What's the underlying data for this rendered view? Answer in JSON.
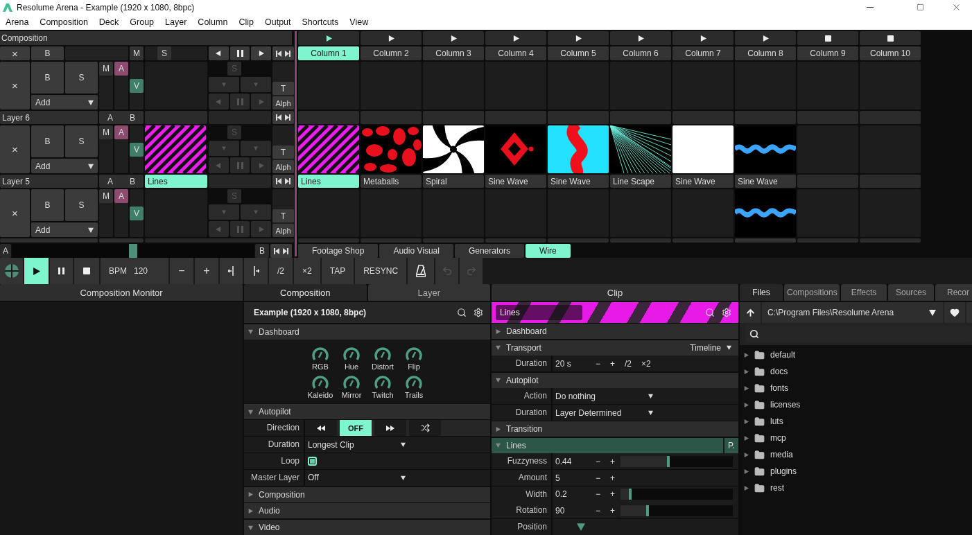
{
  "window": {
    "title": "Resolume Arena - Example (1920 x 1080, 8bpc)"
  },
  "menu": [
    "Arena",
    "Composition",
    "Deck",
    "Group",
    "Layer",
    "Column",
    "Clip",
    "Output",
    "Shortcuts",
    "View"
  ],
  "composition_bar": {
    "title": "Composition",
    "clear": "×",
    "bypass": "B",
    "mute": "M",
    "solo": "S"
  },
  "columns": [
    {
      "name": "Column 1",
      "kind": "play",
      "selected": true
    },
    {
      "name": "Column 2",
      "kind": "play",
      "selected": false
    },
    {
      "name": "Column 3",
      "kind": "play",
      "selected": false
    },
    {
      "name": "Column 4",
      "kind": "play",
      "selected": false
    },
    {
      "name": "Column 5",
      "kind": "play",
      "selected": false
    },
    {
      "name": "Column 6",
      "kind": "play",
      "selected": false
    },
    {
      "name": "Column 7",
      "kind": "play",
      "selected": false
    },
    {
      "name": "Column 8",
      "kind": "play",
      "selected": false
    },
    {
      "name": "Column 9",
      "kind": "stop",
      "selected": false
    },
    {
      "name": "Column 10",
      "kind": "stop",
      "selected": false
    }
  ],
  "layers": [
    {
      "name": "Layer 6",
      "clear": "×",
      "bypass": "B",
      "solo": "S",
      "add": "Add",
      "mute": "M",
      "audio": "A",
      "video": "V",
      "dim_solo": "S",
      "transition": "T",
      "blend": "Alph",
      "crossfade_a": "A",
      "crossfade_b": "B",
      "clips": [
        {
          "kind": "empty"
        },
        {
          "kind": "empty"
        },
        {
          "kind": "empty"
        },
        {
          "kind": "empty"
        },
        {
          "kind": "empty"
        },
        {
          "kind": "empty"
        },
        {
          "kind": "empty"
        },
        {
          "kind": "empty"
        },
        {
          "kind": "empty"
        },
        {
          "kind": "empty"
        }
      ]
    },
    {
      "name": "Layer 5",
      "clear": "×",
      "bypass": "B",
      "solo": "S",
      "add": "Add",
      "mute": "M",
      "audio": "A",
      "video": "V",
      "dim_solo": "S",
      "transition": "T",
      "blend": "Alph",
      "crossfade_a": "A",
      "crossfade_b": "B",
      "preview": {
        "name": "Lines",
        "kind": "lines"
      },
      "clips": [
        {
          "name": "Lines",
          "kind": "lines",
          "selected": true
        },
        {
          "name": "Metaballs",
          "kind": "metaballs",
          "selected": false
        },
        {
          "name": "Spiral",
          "kind": "spiral",
          "selected": false
        },
        {
          "name": "Sine Wave",
          "kind": "sinewave_red",
          "selected": false
        },
        {
          "name": "Sine Wave",
          "kind": "sinewave_cyan",
          "selected": false
        },
        {
          "name": "Line Scape",
          "kind": "linescape",
          "selected": false
        },
        {
          "name": "Sine Wave",
          "kind": "white",
          "selected": false
        },
        {
          "name": "Sine Wave",
          "kind": "sinewave_blue",
          "selected": false
        },
        {
          "kind": "empty"
        },
        {
          "kind": "empty"
        }
      ]
    },
    {
      "clear": "×",
      "bypass": "B",
      "solo": "S",
      "add": "Add",
      "mute": "M",
      "audio": "A",
      "video": "V",
      "dim_solo": "S",
      "transition": "T",
      "blend": "Alph",
      "clips": [
        {
          "kind": "empty"
        },
        {
          "kind": "empty"
        },
        {
          "kind": "empty"
        },
        {
          "kind": "empty"
        },
        {
          "kind": "empty"
        },
        {
          "kind": "empty"
        },
        {
          "kind": "empty"
        },
        {
          "kind": "sinewave_blue",
          "selected": false
        },
        {
          "kind": "empty"
        },
        {
          "kind": "empty"
        }
      ]
    }
  ],
  "crossfader": {
    "a": "A",
    "b": "B",
    "level": 0.5
  },
  "deck_tabs": [
    {
      "label": "Footage Shop",
      "selected": false
    },
    {
      "label": "Audio Visual",
      "selected": false
    },
    {
      "label": "Generators",
      "selected": false
    },
    {
      "label": "Wire",
      "selected": true
    }
  ],
  "transport": [
    {
      "kind": "logo"
    },
    {
      "kind": "play",
      "selected": true
    },
    {
      "kind": "pause",
      "selected": false
    },
    {
      "kind": "stop",
      "selected": false
    },
    {
      "kind": "bpm",
      "label": "BPM",
      "value": "120"
    },
    {
      "kind": "text",
      "label": "−"
    },
    {
      "kind": "text",
      "label": "+"
    },
    {
      "kind": "nudge_back"
    },
    {
      "kind": "nudge_forward"
    },
    {
      "kind": "text",
      "label": "/2"
    },
    {
      "kind": "text",
      "label": "×2"
    },
    {
      "kind": "text",
      "label": "TAP"
    },
    {
      "kind": "text",
      "label": "RESYNC"
    },
    {
      "kind": "metronome"
    },
    {
      "kind": "undo",
      "disabled": true
    },
    {
      "kind": "redo",
      "disabled": true
    }
  ],
  "monitor": {
    "title": "Composition Monitor"
  },
  "comp_panel": {
    "tabs": [
      {
        "label": "Composition",
        "selected": true
      },
      {
        "label": "Layer",
        "selected": false
      }
    ],
    "header": "Example (1920 x 1080, 8bpc)",
    "sections": [
      {
        "title": "Dashboard",
        "expanded": true,
        "knobs": [
          "RGB",
          "Hue",
          "Distort",
          "Flip",
          "Kaleido",
          "Mirror",
          "Twitch",
          "Trails"
        ]
      },
      {
        "title": "Autopilot",
        "expanded": true,
        "rows": [
          {
            "kind": "segmented",
            "label": "Direction",
            "options": [
              {
                "kind": "rewind",
                "selected": false
              },
              {
                "kind": "text",
                "label": "OFF",
                "selected": true
              },
              {
                "kind": "forward",
                "selected": false
              },
              {
                "kind": "shuffle",
                "selected": false
              }
            ]
          },
          {
            "kind": "dropdown",
            "label": "Duration",
            "value": "Longest Clip"
          },
          {
            "kind": "checkbox",
            "label": "Loop",
            "checked": true
          },
          {
            "kind": "dropdown",
            "label": "Master Layer",
            "value": "Off"
          }
        ]
      },
      {
        "title": "Composition",
        "expanded": false
      },
      {
        "title": "Audio",
        "expanded": false
      },
      {
        "title": "Video",
        "expanded": true
      }
    ]
  },
  "clip_panel": {
    "title": "Clip",
    "clip_name": "Lines",
    "sections": [
      {
        "title": "Dashboard",
        "expanded": false
      },
      {
        "title": "Transport",
        "expanded": true,
        "mode": "Timeline",
        "rows": [
          {
            "kind": "number",
            "label": "Duration",
            "value": "20 s",
            "buttons": [
              "−",
              "+",
              "/2",
              "×2"
            ]
          }
        ]
      },
      {
        "title": "Autopilot",
        "expanded": true,
        "rows": [
          {
            "kind": "dropdown",
            "label": "Action",
            "value": "Do nothing"
          },
          {
            "kind": "dropdown",
            "label": "Duration",
            "value": "Layer Determined"
          }
        ]
      },
      {
        "title": "Transition",
        "expanded": false
      },
      {
        "title": "Lines",
        "expanded": true,
        "active": true,
        "button": "P.",
        "rows": [
          {
            "kind": "slider",
            "label": "Fuzzyness",
            "value": "0.44",
            "buttons": [
              "−",
              "+"
            ],
            "level": 0.44
          },
          {
            "kind": "number",
            "label": "Amount",
            "value": "5",
            "buttons": [
              "−",
              "+"
            ]
          },
          {
            "kind": "slider",
            "label": "Width",
            "value": "0.2",
            "buttons": [
              "−",
              "+"
            ],
            "level": 0.1
          },
          {
            "kind": "slider",
            "label": "Rotation",
            "value": "90",
            "buttons": [
              "−",
              "+"
            ],
            "level": 0.25
          },
          {
            "kind": "position",
            "label": "Position",
            "level": 0.12
          }
        ]
      }
    ]
  },
  "files_panel": {
    "tabs": [
      {
        "label": "Files",
        "selected": true
      },
      {
        "label": "Compositions",
        "selected": false
      },
      {
        "label": "Effects",
        "selected": false
      },
      {
        "label": "Sources",
        "selected": false
      },
      {
        "label": "Recor",
        "selected": false
      }
    ],
    "path": "C:\\Program Files\\Resolume Arena",
    "folders": [
      {
        "name": "default",
        "expanded": false
      },
      {
        "name": "docs",
        "expanded": false
      },
      {
        "name": "fonts",
        "expanded": false
      },
      {
        "name": "licenses",
        "expanded": false
      },
      {
        "name": "luts",
        "expanded": false
      },
      {
        "name": "mcp",
        "expanded": false
      },
      {
        "name": "media",
        "expanded": false
      },
      {
        "name": "plugins",
        "expanded": false
      },
      {
        "name": "rest",
        "expanded": false
      }
    ]
  }
}
